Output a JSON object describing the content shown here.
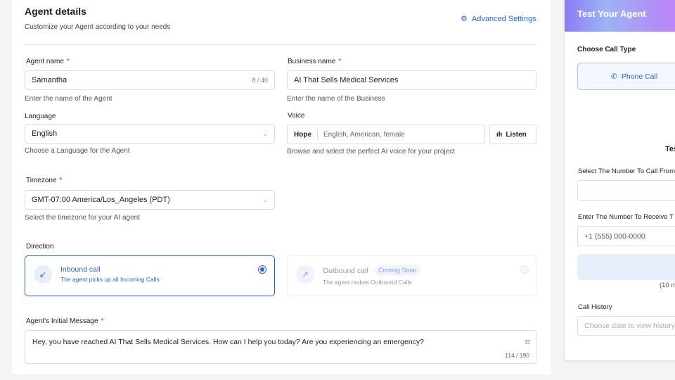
{
  "header": {
    "title": "Agent details",
    "subtitle": "Customize your Agent according to your needs",
    "advanced": "Advanced Settings"
  },
  "agent_name": {
    "label": "Agent name",
    "value": "Samantha",
    "counter": "8 / 40",
    "help": "Enter the name of the Agent"
  },
  "business_name": {
    "label": "Business name",
    "value": "AI That Sells Medical Services",
    "help": "Enter the name of the Business"
  },
  "language": {
    "label": "Language",
    "value": "English",
    "help": "Choose a Language for the Agent"
  },
  "voice": {
    "label": "Voice",
    "name": "Hope",
    "desc": "English, American, female",
    "listen": "Listen",
    "help": "Browse and select the perfect AI voice for your project"
  },
  "timezone": {
    "label": "Timezone",
    "value": "GMT-07:00 America/Los_Angeles (PDT)",
    "help": "Select the timezone for your AI agent"
  },
  "direction": {
    "label": "Direction",
    "inbound": {
      "title": "Inbound call",
      "desc": "The agent picks up all Incoming Calls"
    },
    "outbound": {
      "title": "Outbound call",
      "badge": "Coming Soon",
      "desc": "The agent makes Outbound Calls"
    }
  },
  "initial_message": {
    "label": "Agent's Initial Message",
    "value": "Hey, you have reached AI That Sells Medical Services. How can I help you today? Are you experiencing an emergency?",
    "counter": "114 / 190"
  },
  "test_panel": {
    "title": "Test Your Agent",
    "call_type_label": "Choose Call Type",
    "phone_call": "Phone Call",
    "section_title": "Tes",
    "from_label": "Select The Number To Call From",
    "to_label": "Enter The Number To Receive T",
    "to_placeholder": "+1 (555) 000-0000",
    "note": "(10 m",
    "history_label": "Call History",
    "history_placeholder": "Choose date to view history"
  }
}
